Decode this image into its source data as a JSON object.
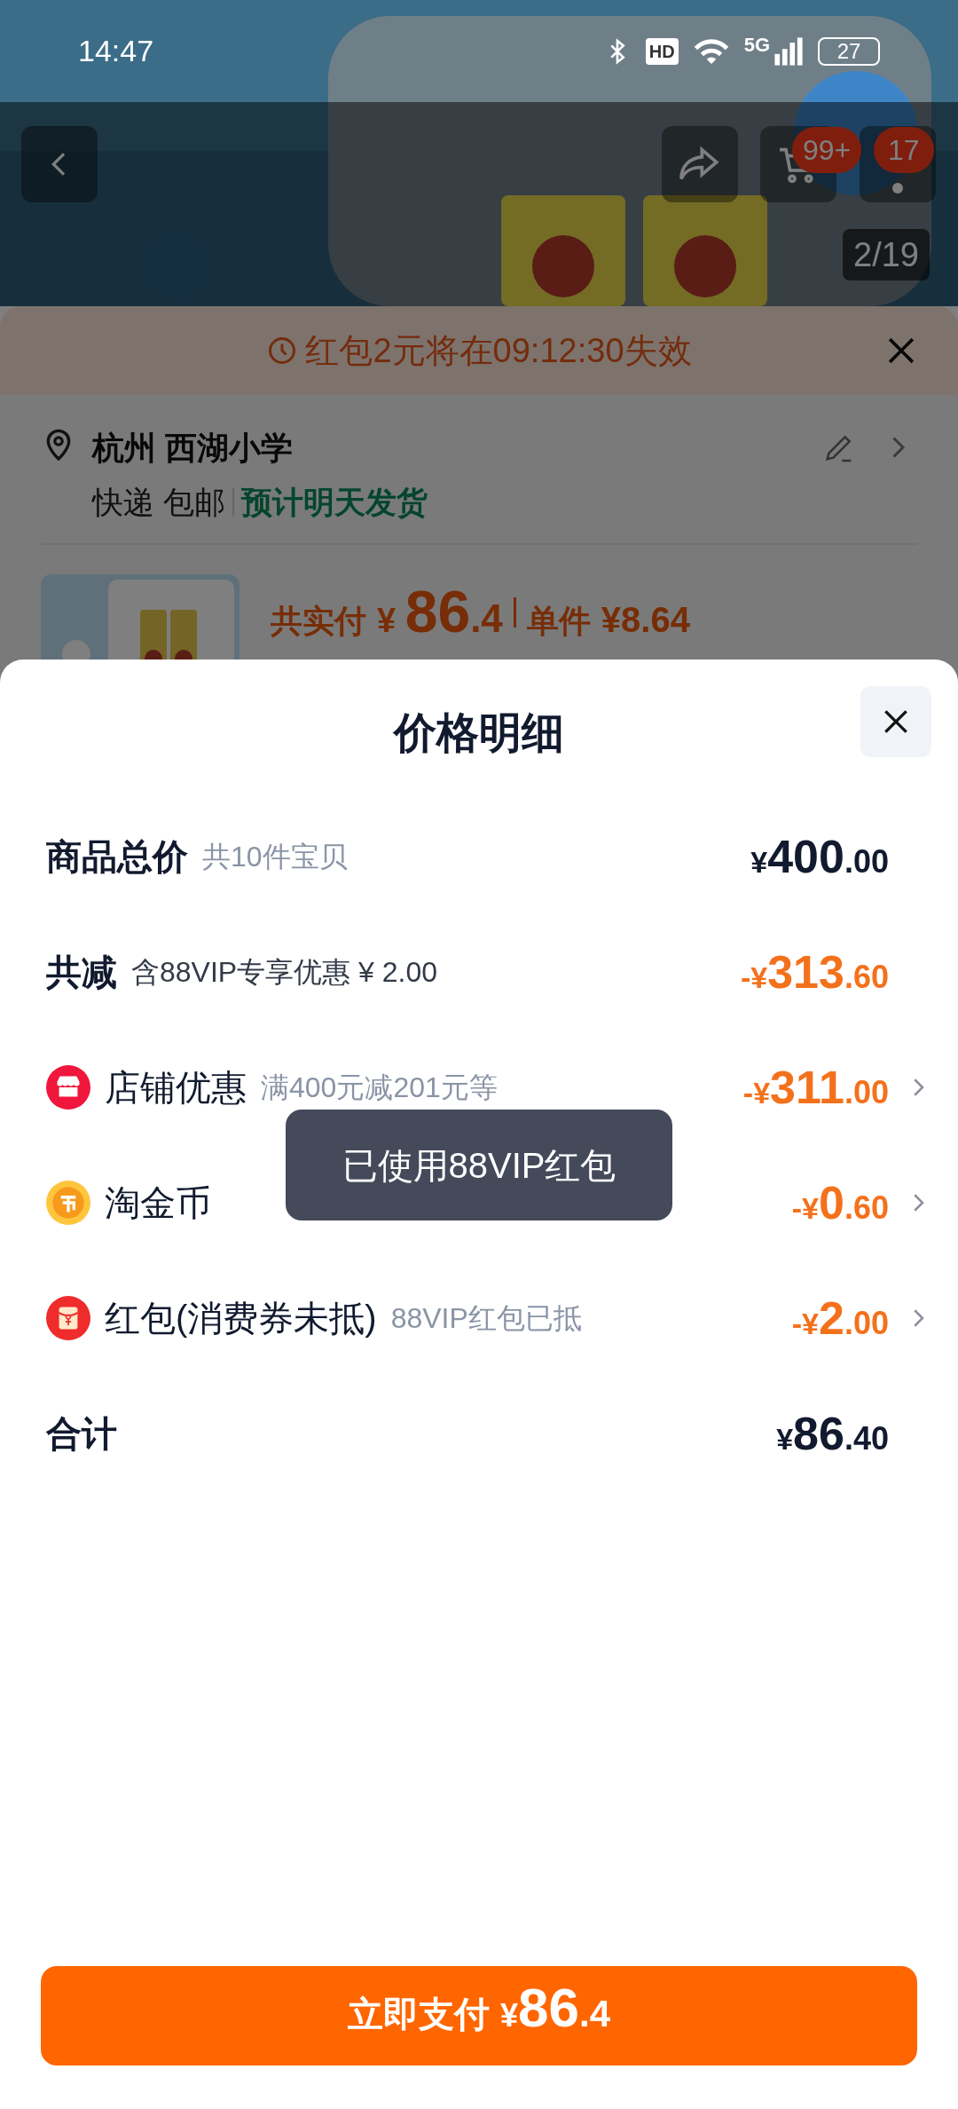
{
  "status_bar": {
    "time": "14:47",
    "hd": "HD",
    "network": "5G",
    "battery": "27"
  },
  "background": {
    "cart_badge": "99+",
    "more_badge": "17",
    "counter": "2/19",
    "countdown": "红包2元将在09:12:30失效",
    "address": {
      "name": "杭州 西湖小学",
      "shipping": "快递 包邮",
      "estimate": "预计明天发货"
    },
    "summary": {
      "label": "共实付",
      "amount": "¥ 86.4",
      "unit_label": "单件",
      "unit_price": "¥8.64"
    }
  },
  "sheet": {
    "title": "价格明细",
    "rows": [
      {
        "kind": "total",
        "label": "商品总价",
        "note": "共10件宝贝",
        "amount": "¥400.00",
        "discount": false,
        "chevron": false
      },
      {
        "kind": "total",
        "label": "共减",
        "note": "含88VIP专享优惠 ¥ 2.00",
        "amount": "-¥313.60",
        "discount": true,
        "chevron": false
      },
      {
        "kind": "store",
        "label": "店铺优惠",
        "note": "满400元减201元等",
        "amount": "-¥311.00",
        "discount": true,
        "chevron": true
      },
      {
        "kind": "coin",
        "label": "淘金币",
        "amount": "-¥0.60",
        "discount": true,
        "chevron": true
      },
      {
        "kind": "redpacket",
        "label": "红包(消费券未抵)",
        "note": "88VIP红包已抵",
        "amount": "-¥2.00",
        "discount": true,
        "chevron": true
      },
      {
        "kind": "total",
        "label": "合计",
        "amount": "¥86.40",
        "discount": false,
        "chevron": false
      }
    ]
  },
  "toast": "已使用88VIP红包",
  "pay_button": {
    "label": "立即支付",
    "amount": "¥86.4"
  }
}
